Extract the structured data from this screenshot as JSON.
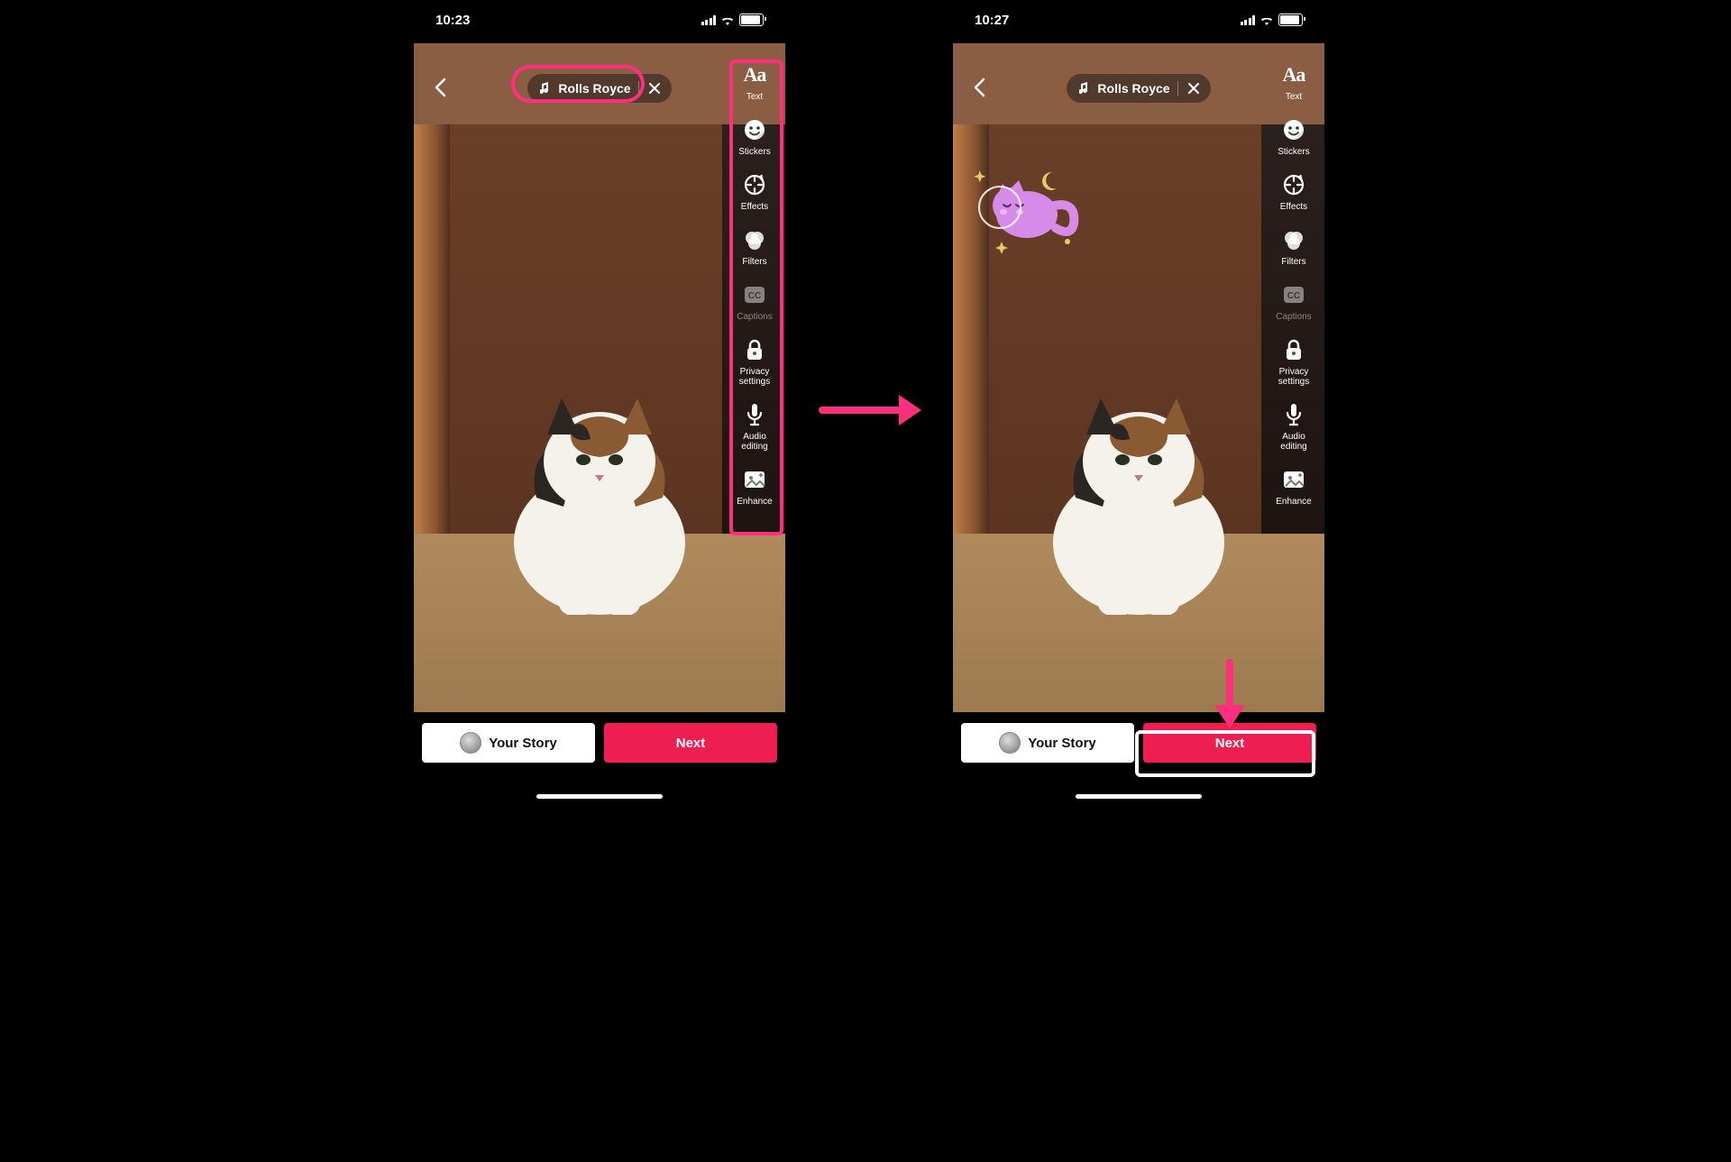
{
  "colors": {
    "accent": "#ee1d52",
    "annotation": "#ff2f7e"
  },
  "left": {
    "status_time": "10:23",
    "sound_label": "Rolls Royce",
    "bottom": {
      "story_label": "Your Story",
      "next_label": "Next"
    },
    "tools": [
      {
        "name": "text",
        "label": "Text"
      },
      {
        "name": "stickers",
        "label": "Stickers"
      },
      {
        "name": "effects",
        "label": "Effects"
      },
      {
        "name": "filters",
        "label": "Filters"
      },
      {
        "name": "captions",
        "label": "Captions",
        "dim": true
      },
      {
        "name": "privacy",
        "label": "Privacy settings"
      },
      {
        "name": "audio",
        "label": "Audio editing"
      },
      {
        "name": "enhance",
        "label": "Enhance"
      }
    ]
  },
  "right": {
    "status_time": "10:27",
    "sound_label": "Rolls Royce",
    "bottom": {
      "story_label": "Your Story",
      "next_label": "Next"
    },
    "tools": [
      {
        "name": "text",
        "label": "Text"
      },
      {
        "name": "stickers",
        "label": "Stickers"
      },
      {
        "name": "effects",
        "label": "Effects"
      },
      {
        "name": "filters",
        "label": "Filters"
      },
      {
        "name": "captions",
        "label": "Captions",
        "dim": true
      },
      {
        "name": "privacy",
        "label": "Privacy settings"
      },
      {
        "name": "audio",
        "label": "Audio editing"
      },
      {
        "name": "enhance",
        "label": "Enhance"
      }
    ],
    "sticker_name": "flying-cat-sticker"
  }
}
